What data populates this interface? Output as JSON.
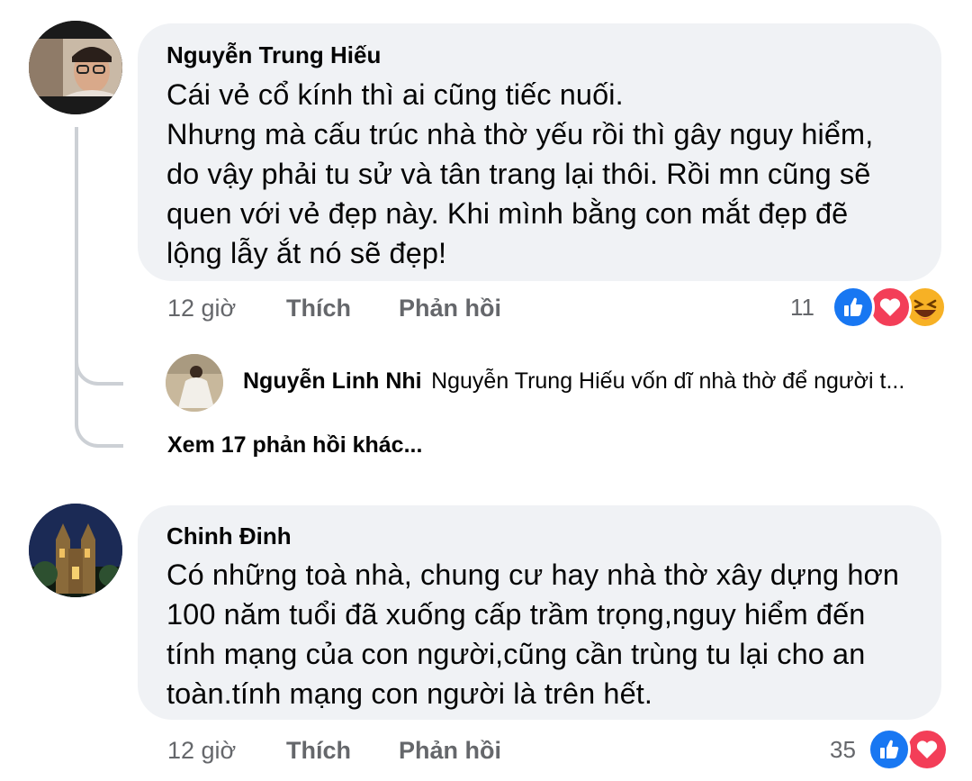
{
  "comments": [
    {
      "author": "Nguyễn Trung Hiếu",
      "lines": [
        "Cái vẻ cổ kính thì ai cũng tiếc nuối.",
        "Nhưng mà cấu trúc nhà thờ yếu rồi thì gây nguy hiểm,",
        "do vậy phải tu sử và tân trang lại thôi. Rồi mn cũng sẽ",
        "quen với vẻ đẹp này. Khi mình bằng con mắt đẹp đẽ",
        "lộng lẫy ắt nó sẽ đẹp!"
      ],
      "time": "12 giờ",
      "like_label": "Thích",
      "reply_label": "Phản hồi",
      "reaction_count": "11",
      "reactions": [
        "like-icon",
        "love-icon",
        "haha-icon"
      ]
    },
    {
      "author": "Chinh Đinh",
      "lines": [
        "Có những toà nhà, chung cư hay nhà thờ xây dựng hơn",
        "100 năm tuổi đã xuống cấp trầm trọng,nguy hiểm đến",
        "tính mạng của con người,cũng cần trùng tu lại cho an",
        "toàn.tính mạng con người là trên hết."
      ],
      "time": "12 giờ",
      "like_label": "Thích",
      "reply_label": "Phản hồi",
      "reaction_count": "35",
      "reactions": [
        "like-icon",
        "love-icon"
      ]
    }
  ],
  "reply_preview": {
    "author": "Nguyễn Linh Nhi",
    "text": "Nguyễn Trung Hiếu vốn dĩ nhà thờ để người t..."
  },
  "more_replies": "Xem 17 phản hồi khác...",
  "colors": {
    "bubble": "#f0f2f5",
    "meta": "#65676b",
    "like": "#1877f2",
    "love": "#f33e58",
    "haha": "#f7b125"
  }
}
